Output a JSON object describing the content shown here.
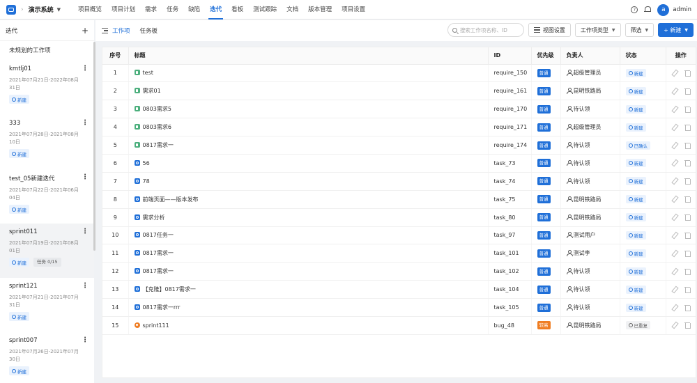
{
  "header": {
    "project_name": "演示系统",
    "nav": [
      {
        "label": "项目概览",
        "active": false
      },
      {
        "label": "项目计划",
        "active": false
      },
      {
        "label": "需求",
        "active": false
      },
      {
        "label": "任务",
        "active": false
      },
      {
        "label": "缺陷",
        "active": false
      },
      {
        "label": "迭代",
        "active": true
      },
      {
        "label": "看板",
        "active": false
      },
      {
        "label": "测试跟踪",
        "active": false
      },
      {
        "label": "文档",
        "active": false
      },
      {
        "label": "版本管理",
        "active": false
      },
      {
        "label": "项目设置",
        "active": false
      }
    ],
    "help_glyph": "?",
    "avatar_letter": "a",
    "user_name": "admin"
  },
  "sidebar": {
    "title": "迭代",
    "add_glyph": "+",
    "unplanned": "未规划的工作项",
    "sprints": [
      {
        "name": "kmtlj01",
        "date": "2021年07月21日-2022年08月31日",
        "status": "新建",
        "task_count": "",
        "selected": false
      },
      {
        "name": "333",
        "date": "2021年07月28日-2021年08月10日",
        "status": "新建",
        "task_count": "",
        "selected": false
      },
      {
        "name": "test_05新建迭代",
        "date": "2021年07月22日-2021年06月04日",
        "status": "新建",
        "task_count": "",
        "selected": false
      },
      {
        "name": "sprint011",
        "date": "2021年07月19日-2021年08月01日",
        "status": "新建",
        "task_count": "任务 0/15",
        "selected": true
      },
      {
        "name": "sprint121",
        "date": "2021年07月21日-2021年07月31日",
        "status": "新建",
        "task_count": "",
        "selected": false
      },
      {
        "name": "sprint007",
        "date": "2021年07月26日-2021年07月30日",
        "status": "新建",
        "task_count": "",
        "selected": false
      }
    ]
  },
  "toolbar": {
    "tab_work": "工作项",
    "tab_board": "任务板",
    "search_placeholder": "搜索工作项名称、ID",
    "view_settings": "视图设置",
    "type_filter": "工作项类型",
    "filter": "筛选",
    "new_button": "+ 新建"
  },
  "table": {
    "columns": [
      "序号",
      "标题",
      "ID",
      "优先级",
      "负责人",
      "状态",
      "操作"
    ],
    "rows": [
      {
        "idx": "1",
        "type": "requirement",
        "title": "test",
        "id": "require_150",
        "priority": "普通",
        "pri_class": "normal",
        "owner": "超级管理员",
        "status": "新建",
        "status_class": "s-new"
      },
      {
        "idx": "2",
        "type": "requirement",
        "title": "需求01",
        "id": "require_161",
        "priority": "普通",
        "pri_class": "normal",
        "owner": "昆明铁路局",
        "status": "新建",
        "status_class": "s-new"
      },
      {
        "idx": "3",
        "type": "requirement",
        "title": "0803需求5",
        "id": "require_170",
        "priority": "普通",
        "pri_class": "normal",
        "owner": "待认领",
        "status": "新建",
        "status_class": "s-new"
      },
      {
        "idx": "4",
        "type": "requirement",
        "title": "0803需求6",
        "id": "require_171",
        "priority": "普通",
        "pri_class": "normal",
        "owner": "超级管理员",
        "status": "新建",
        "status_class": "s-new"
      },
      {
        "idx": "5",
        "type": "requirement",
        "title": "0817需求一",
        "id": "require_174",
        "priority": "普通",
        "pri_class": "normal",
        "owner": "待认领",
        "status": "已确认",
        "status_class": "s-confirmed"
      },
      {
        "idx": "6",
        "type": "task",
        "title": "56",
        "id": "task_73",
        "priority": "普通",
        "pri_class": "normal",
        "owner": "待认领",
        "status": "新建",
        "status_class": "s-new"
      },
      {
        "idx": "7",
        "type": "task",
        "title": "78",
        "id": "task_74",
        "priority": "普通",
        "pri_class": "normal",
        "owner": "待认领",
        "status": "新建",
        "status_class": "s-new"
      },
      {
        "idx": "8",
        "type": "task",
        "title": "前端页面——版本发布",
        "id": "task_75",
        "priority": "普通",
        "pri_class": "normal",
        "owner": "昆明铁路局",
        "status": "新建",
        "status_class": "s-new"
      },
      {
        "idx": "9",
        "type": "task",
        "title": "需求分析",
        "id": "task_80",
        "priority": "普通",
        "pri_class": "normal",
        "owner": "昆明铁路局",
        "status": "新建",
        "status_class": "s-new"
      },
      {
        "idx": "10",
        "type": "task",
        "title": "0817任务一",
        "id": "task_97",
        "priority": "普通",
        "pri_class": "normal",
        "owner": "测试用户",
        "status": "新建",
        "status_class": "s-new"
      },
      {
        "idx": "11",
        "type": "task",
        "title": "0817需求一",
        "id": "task_101",
        "priority": "普通",
        "pri_class": "normal",
        "owner": "测试李",
        "status": "新建",
        "status_class": "s-new"
      },
      {
        "idx": "12",
        "type": "task",
        "title": "0817需求一",
        "id": "task_102",
        "priority": "普通",
        "pri_class": "normal",
        "owner": "待认领",
        "status": "新建",
        "status_class": "s-new"
      },
      {
        "idx": "13",
        "type": "task",
        "title": "【克隆】0817需求一",
        "id": "task_104",
        "priority": "普通",
        "pri_class": "normal",
        "owner": "待认领",
        "status": "新建",
        "status_class": "s-new"
      },
      {
        "idx": "14",
        "type": "task",
        "title": "0817需求一rrr",
        "id": "task_105",
        "priority": "普通",
        "pri_class": "normal",
        "owner": "待认领",
        "status": "新建",
        "status_class": "s-new"
      },
      {
        "idx": "15",
        "type": "bug",
        "title": "sprint111",
        "id": "bug_48",
        "priority": "较高",
        "pri_class": "high",
        "owner": "昆明铁路局",
        "status": "已重复",
        "status_class": "s-reopen"
      }
    ]
  },
  "colors": {
    "accent": "#1f6fd8",
    "requirement": "#4caf7d",
    "bug": "#ef7d22",
    "priority_high": "#ef7d22"
  }
}
